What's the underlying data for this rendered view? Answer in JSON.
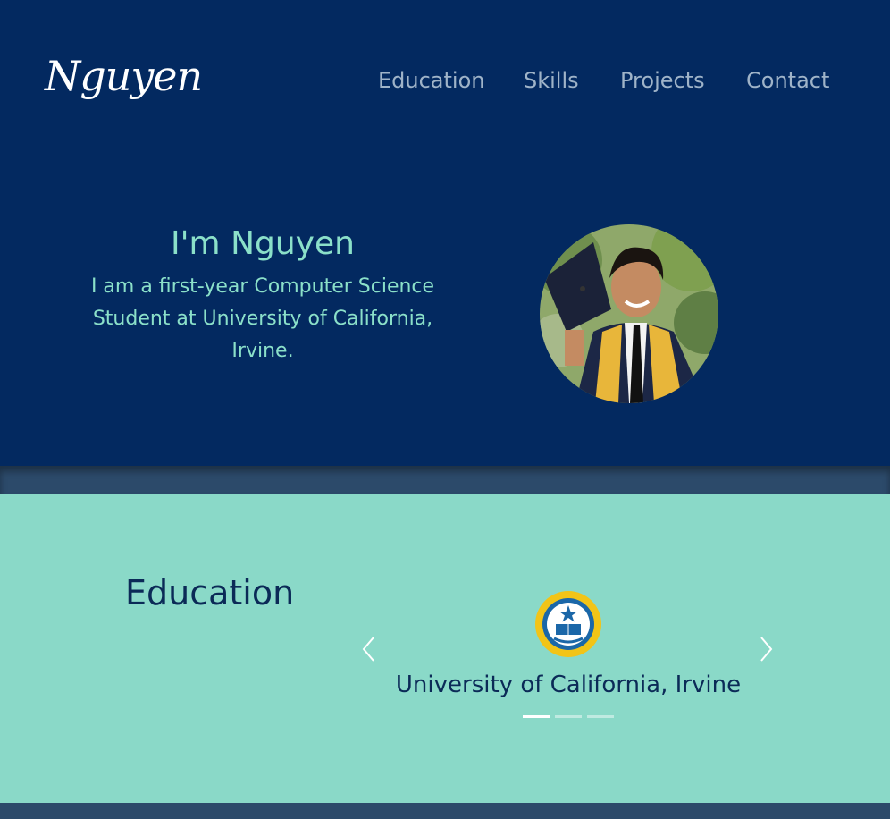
{
  "header": {
    "logo_text": "Nguyen",
    "nav": [
      {
        "label": "Education"
      },
      {
        "label": "Skills"
      },
      {
        "label": "Projects"
      },
      {
        "label": "Contact"
      }
    ]
  },
  "hero": {
    "heading": "I'm Nguyen",
    "description": "I am a first-year Computer Science Student at University of California, Irvine."
  },
  "education": {
    "title": "Education",
    "carousel": {
      "slides": [
        {
          "name": "University of California, Irvine"
        }
      ],
      "indicator_count": 3,
      "active_index": 0
    }
  },
  "colors": {
    "navy": "#032960",
    "mint": "#8ad9c8",
    "accent_text": "#8be0c9",
    "nav_text": "#9fb3c8",
    "seal_gold": "#f2c417",
    "seal_blue": "#1b67a8"
  }
}
